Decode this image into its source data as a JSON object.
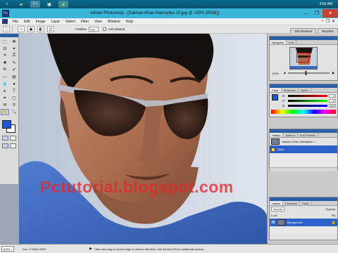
{
  "taskbar": {
    "icons": [
      "ie-icon",
      "folder-icon",
      "photoshop-icon",
      "media-icon",
      "green-app-icon"
    ],
    "clock": "4:56 AM"
  },
  "window": {
    "app_icon": "Ps",
    "title": "Adobe Photoshop - [Salman-Khan-Hairstyles-10.jpg @ 100% (RGB)]",
    "minimize": "–",
    "restore": "❐",
    "close": "✕"
  },
  "menu": {
    "items": [
      "File",
      "Edit",
      "Image",
      "Layer",
      "Select",
      "Filter",
      "View",
      "Window",
      "Help"
    ]
  },
  "options": {
    "feather_label": "Feather:",
    "feather_value": "0 px",
    "antialias_label": "Anti-aliased",
    "well_tabs": [
      "File Browser",
      "Brushes"
    ]
  },
  "toolbox": {
    "tools": [
      "marquee",
      "move",
      "lasso",
      "magic-wand",
      "crop",
      "slice",
      "healing",
      "brush",
      "stamp",
      "history-brush",
      "eraser",
      "gradient",
      "blur",
      "dodge",
      "path-select",
      "type",
      "pen",
      "shape",
      "notes",
      "eyedropper",
      "hand",
      "zoom"
    ],
    "glyphs": [
      "⬚",
      "✥",
      "ʘ",
      "✦",
      "⌗",
      "⚿",
      "✚",
      "✎",
      "⎆",
      "✐",
      "▭",
      "▤",
      "💧",
      "●",
      "▸",
      "T",
      "✒",
      "▢",
      "✉",
      "⚲",
      "✋",
      "🔍"
    ],
    "fg_color": "#1c56d0",
    "bg_color": "#ffffff"
  },
  "canvas": {
    "watermark": "Pctutorial.blogspot.com"
  },
  "navigator": {
    "tabs": [
      "Navigator",
      "Info"
    ],
    "zoom": "100%"
  },
  "color": {
    "tabs": [
      "Color",
      "Swatches",
      "Styles"
    ],
    "rows": [
      {
        "label": "R",
        "value": "0"
      },
      {
        "label": "G",
        "value": "71"
      },
      {
        "label": "B",
        "value": "254"
      }
    ],
    "fg_color": "#1c56d0"
  },
  "history": {
    "tabs": [
      "History",
      "Actions",
      "Tool Presets"
    ],
    "snapshot": "Salman-Khan-Hairstyles-1...",
    "step": "Open"
  },
  "layers": {
    "tabs": [
      "Layers",
      "Channels",
      "Paths"
    ],
    "blend": "Normal",
    "opacity_label": "Opacity:",
    "lock_label": "Lock:",
    "fill_label": "Fill:",
    "layer_name": "Background"
  },
  "status": {
    "zoom": "100%",
    "doc": "Doc: 2.92M/2.92M",
    "hint": "Click and drag to scroll image in desired direction. Use Alt and Ctrl for additional options."
  }
}
